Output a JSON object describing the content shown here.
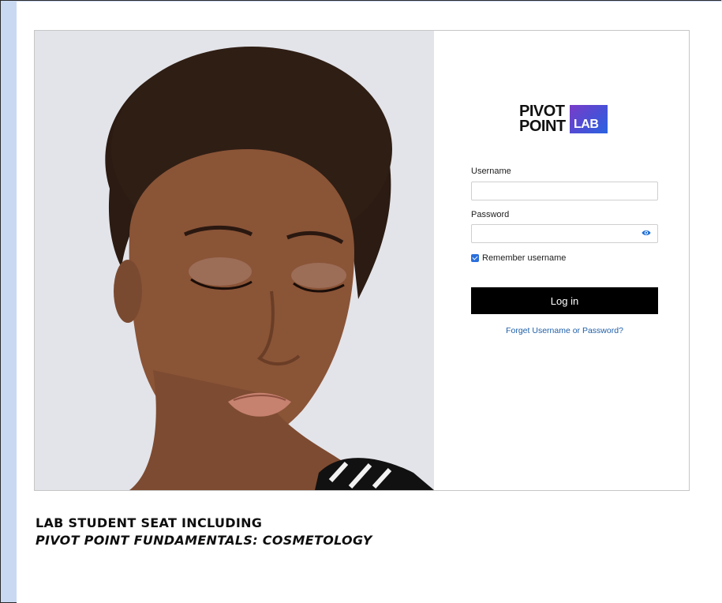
{
  "logo": {
    "line1": "PIVOT",
    "line2": "POINT",
    "badge": "LAB"
  },
  "form": {
    "username_label": "Username",
    "username_value": "",
    "password_label": "Password",
    "password_value": "",
    "remember_label": "Remember username",
    "remember_checked": true,
    "login_label": "Log in",
    "forgot_link": "Forget Username or Password?"
  },
  "caption": {
    "line1": "LAB STUDENT SEAT INCLUDING",
    "line2": "PIVOT POINT FUNDAMENTALS: COSMETOLOGY"
  },
  "colors": {
    "background": "#c9d9f2",
    "button": "#000000",
    "link": "#1e5fa8",
    "logo_gradient": [
      "#7a3cc8",
      "#2a63e0"
    ]
  },
  "icons": {
    "password_toggle": "eye-icon",
    "remember": "checkbox-checked-icon"
  }
}
